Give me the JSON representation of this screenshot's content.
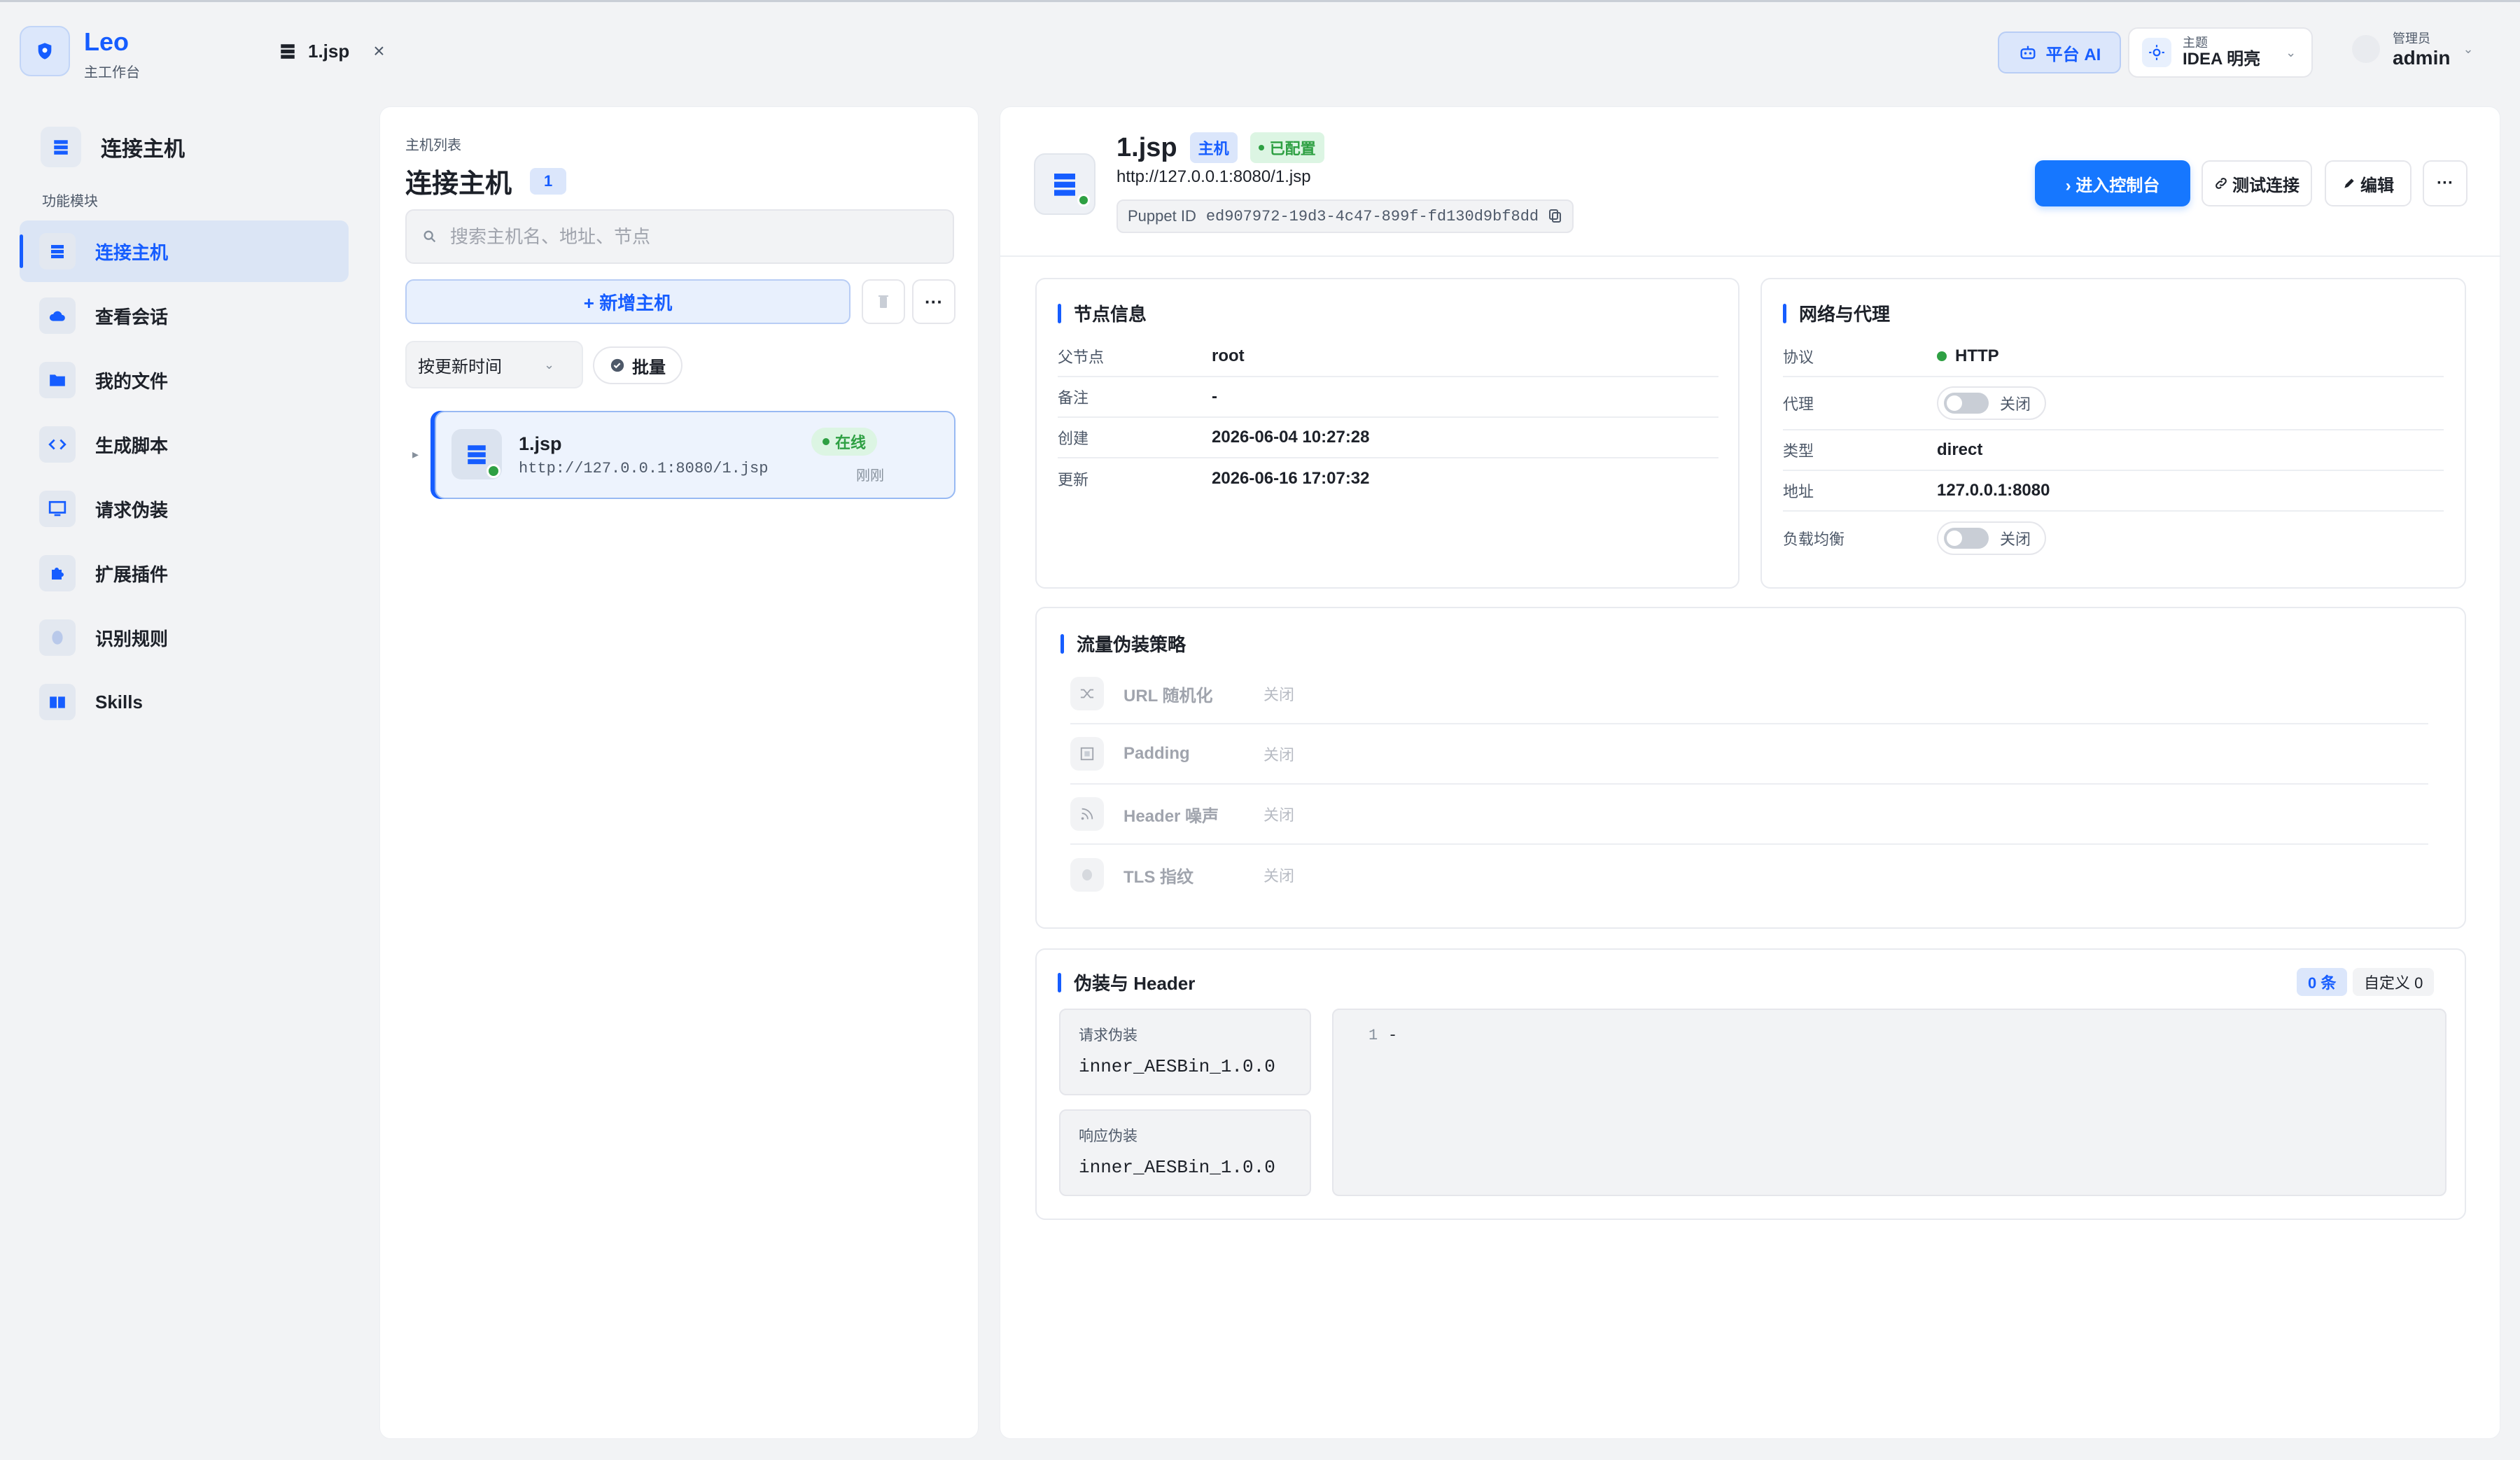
{
  "app": {
    "brand": "Leo",
    "subtitle": "主工作台"
  },
  "tab": {
    "label": "1.jsp",
    "close": "×"
  },
  "header": {
    "ai_label": "平台 AI",
    "theme_label": "主题",
    "theme_value": "IDEA 明亮",
    "user_role": "管理员",
    "user_name": "admin"
  },
  "sidebar": {
    "heading": "连接主机",
    "section": "功能模块",
    "items": [
      {
        "label": "连接主机",
        "icon": "server-icon",
        "active": true
      },
      {
        "label": "查看会话",
        "icon": "cloud-icon"
      },
      {
        "label": "我的文件",
        "icon": "folder-icon"
      },
      {
        "label": "生成脚本",
        "icon": "code-icon"
      },
      {
        "label": "请求伪装",
        "icon": "monitor-icon"
      },
      {
        "label": "扩展插件",
        "icon": "puzzle-icon"
      },
      {
        "label": "识别规则",
        "icon": "fingerprint-icon"
      },
      {
        "label": "Skills",
        "icon": "book-icon"
      }
    ]
  },
  "hostlist": {
    "caption": "主机列表",
    "title": "连接主机",
    "count": "1",
    "search_placeholder": "搜索主机名、地址、节点",
    "add_label": "+ 新增主机",
    "more_label": "···",
    "sort_label": "按更新时间",
    "batch_label": "批量",
    "hosts": [
      {
        "name": "1.jsp",
        "url": "http://127.0.0.1:8080/1.jsp",
        "status": "在线",
        "time": "刚刚"
      }
    ]
  },
  "detail": {
    "name": "1.jsp",
    "tag_type": "主机",
    "tag_status": "已配置",
    "url": "http://127.0.0.1:8080/1.jsp",
    "puppet_label": "Puppet ID",
    "puppet_id": "ed907972-19d3-4c47-899f-fd130d9bf8dd",
    "btn_console": "› 进入控制台",
    "btn_test": "测试连接",
    "btn_edit": "编辑",
    "btn_more": "···",
    "node_info": {
      "title": "节点信息",
      "rows": [
        {
          "k": "父节点",
          "v": "root"
        },
        {
          "k": "备注",
          "v": "-"
        },
        {
          "k": "创建",
          "v": "2026-06-04 10:27:28"
        },
        {
          "k": "更新",
          "v": "2026-06-16 17:07:32"
        }
      ]
    },
    "network": {
      "title": "网络与代理",
      "protocol_label": "协议",
      "protocol": "HTTP",
      "proxy_label": "代理",
      "proxy_state": "关闭",
      "type_label": "类型",
      "type": "direct",
      "address_label": "地址",
      "address": "127.0.0.1:8080",
      "lb_label": "负载均衡",
      "lb_state": "关闭"
    },
    "strategy": {
      "title": "流量伪装策略",
      "items": [
        {
          "name": "URL 随机化",
          "state": "关闭",
          "icon": "shuffle-icon"
        },
        {
          "name": "Padding",
          "state": "关闭",
          "icon": "padding-icon"
        },
        {
          "name": "Header 噪声",
          "state": "关闭",
          "icon": "rss-icon"
        },
        {
          "name": "TLS 指纹",
          "state": "关闭",
          "icon": "fingerprint-icon"
        }
      ]
    },
    "header_card": {
      "title": "伪装与 Header",
      "count_tag": "0 条",
      "custom_tag": "自定义 0",
      "req_label": "请求伪装",
      "req_value": "inner_AESBin_1.0.0",
      "resp_label": "响应伪装",
      "resp_value": "inner_AESBin_1.0.0",
      "line_no": "1",
      "code": "-"
    }
  },
  "colors": {
    "accent": "#165dff",
    "online": "#2ea043"
  }
}
